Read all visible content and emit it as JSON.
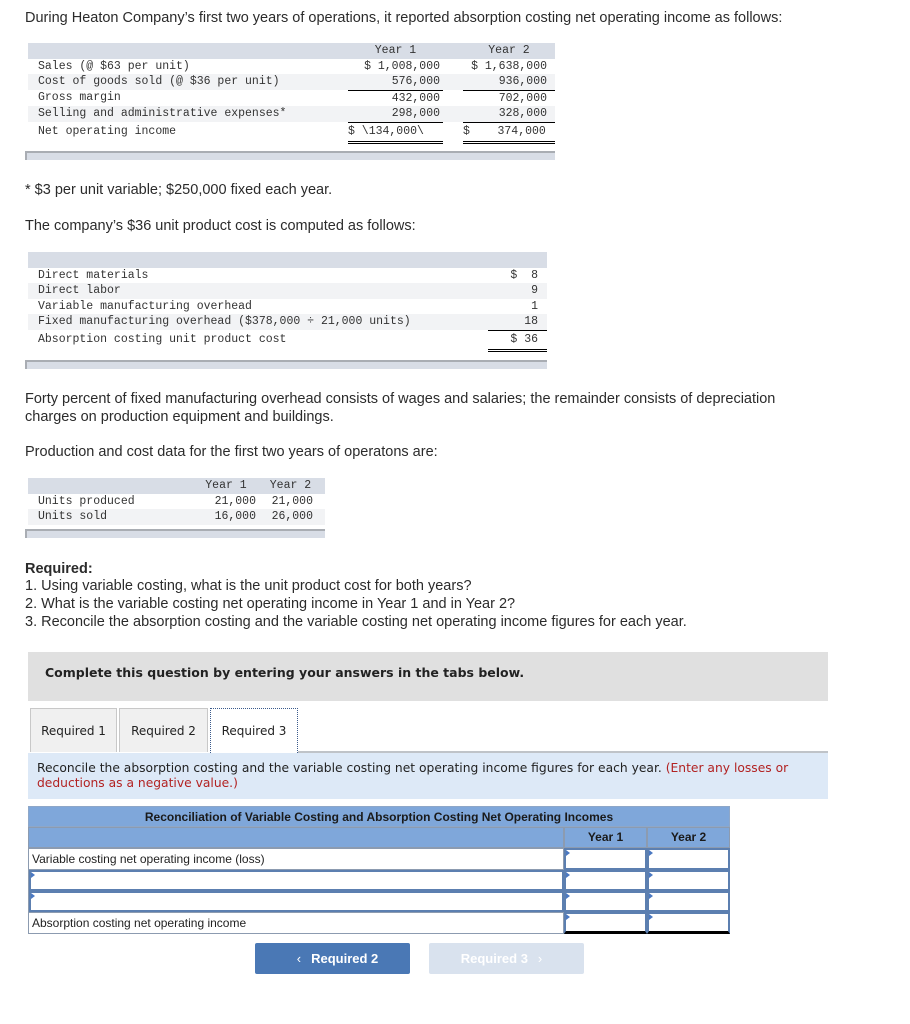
{
  "intro": "During Heaton Company’s first two years of operations, it reported absorption costing net operating income as follows:",
  "income_statement": {
    "headers": [
      "Year 1",
      "Year 2"
    ],
    "rows": [
      {
        "label": "Sales (@ $63 per unit)",
        "y1": "$ 1,008,000",
        "y2": "$ 1,638,000"
      },
      {
        "label": "Cost of goods sold (@ $36 per unit)",
        "y1": "576,000",
        "y2": "936,000"
      },
      {
        "label": "Gross margin",
        "y1": "432,000",
        "y2": "702,000"
      },
      {
        "label": "Selling and administrative expenses*",
        "y1": "298,000",
        "y2": "328,000"
      },
      {
        "label": "Net operating income",
        "y1": "$ \\134,000\\",
        "y2": "$    374,000"
      }
    ]
  },
  "footnote": "* $3 per unit variable; $250,000 fixed each year.",
  "unit_cost_intro": "The company’s $36 unit product cost is computed as follows:",
  "unit_cost": {
    "rows": [
      {
        "label": "Direct materials",
        "value": "$  8"
      },
      {
        "label": "Direct labor",
        "value": "9"
      },
      {
        "label": "Variable manufacturing overhead",
        "value": "1"
      },
      {
        "label": "Fixed manufacturing overhead ($378,000 ÷ 21,000 units)",
        "value": "18"
      },
      {
        "label": "Absorption costing unit product cost",
        "value": "$ 36"
      }
    ]
  },
  "overhead_note": "Forty percent of fixed manufacturing overhead consists of wages and salaries; the remainder consists of depreciation charges on production equipment and buildings.",
  "production_intro": "Production and cost data for the first two years of operatons are:",
  "production": {
    "headers": [
      "Year 1",
      "Year 2"
    ],
    "rows": [
      {
        "label": "Units produced",
        "y1": "21,000",
        "y2": "21,000"
      },
      {
        "label": "Units sold",
        "y1": "16,000",
        "y2": "26,000"
      }
    ]
  },
  "required": {
    "heading": "Required:",
    "items": [
      "1. Using variable costing, what is the unit product cost for both years?",
      "2. What is the variable costing net operating income in Year 1 and in Year 2?",
      "3. Reconcile the absorption costing and the variable costing net operating income figures for each year."
    ]
  },
  "instruction_box": "Complete this question by entering your answers in the tabs below.",
  "tabs": [
    {
      "label": "Required 1",
      "active": false
    },
    {
      "label": "Required 2",
      "active": false
    },
    {
      "label": "Required 3",
      "active": true
    }
  ],
  "prompt": {
    "text": "Reconcile the absorption costing and the variable costing net operating income figures for each year.",
    "note": "(Enter any losses or deductions as a negative value.)"
  },
  "reconciliation": {
    "title": "Reconciliation of Variable Costing and Absorption Costing Net Operating Incomes",
    "col_headers": [
      "Year 1",
      "Year 2"
    ],
    "rows": [
      {
        "label": "Variable costing net operating income (loss)",
        "y1": "",
        "y2": ""
      },
      {
        "label": "",
        "y1": "",
        "y2": ""
      },
      {
        "label": "",
        "y1": "",
        "y2": ""
      },
      {
        "label": "Absorption costing net operating income",
        "y1": "",
        "y2": ""
      }
    ]
  },
  "nav": {
    "prev_label": "Required 2",
    "next_label": "Required 3",
    "prev_icon": "chevron-left-icon",
    "next_icon": "chevron-right-icon"
  }
}
